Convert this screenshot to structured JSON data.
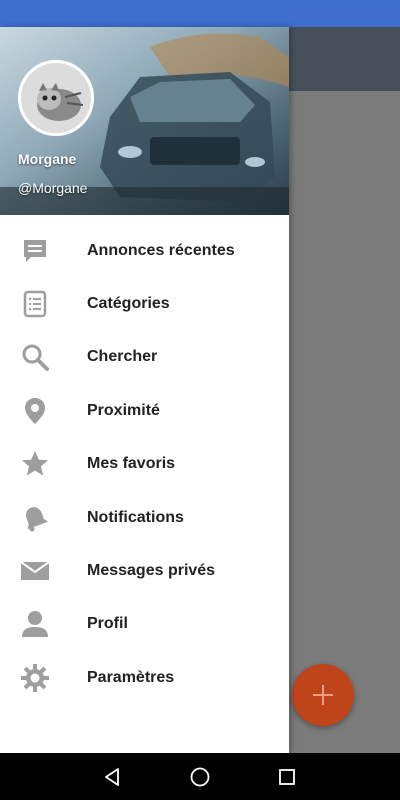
{
  "drawer": {
    "user_name": "Morgane",
    "user_handle": "@Morgane",
    "items": [
      {
        "label": "Annonces récentes",
        "icon": "chat-bubble-icon"
      },
      {
        "label": "Catégories",
        "icon": "list-icon"
      },
      {
        "label": "Chercher",
        "icon": "search-icon"
      },
      {
        "label": "Proximité",
        "icon": "location-pin-icon"
      },
      {
        "label": "Mes favoris",
        "icon": "star-icon"
      },
      {
        "label": "Notifications",
        "icon": "bell-icon"
      },
      {
        "label": "Messages privés",
        "icon": "mail-icon"
      },
      {
        "label": "Profil",
        "icon": "person-icon"
      },
      {
        "label": "Paramètres",
        "icon": "gear-icon"
      }
    ]
  },
  "fab": {
    "icon": "plus-icon"
  },
  "nav": {
    "back_icon": "back-triangle-icon",
    "home_icon": "home-circle-icon",
    "recents_icon": "recents-square-icon"
  },
  "colors": {
    "status_bar": "#3e6fcf",
    "fab": "#c0441a",
    "icon_gray": "#9e9e9e"
  }
}
